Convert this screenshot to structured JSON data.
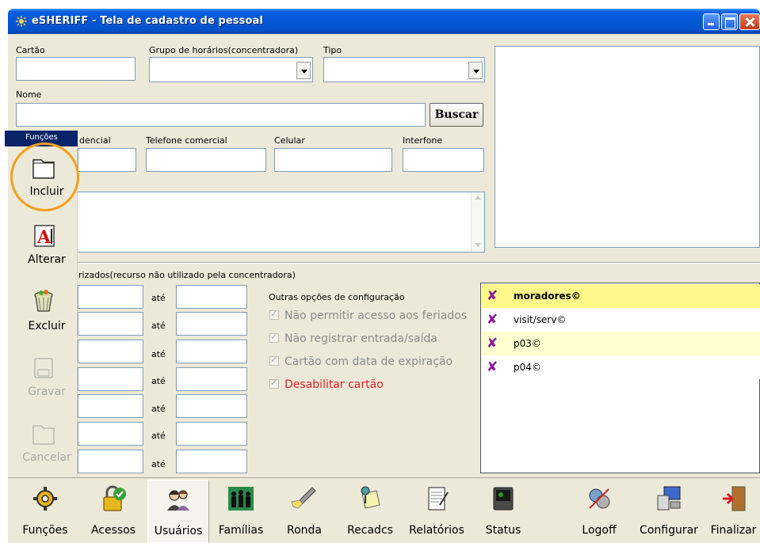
{
  "window": {
    "title": "eSHERIFF - Tela de cadastro de pessoal"
  },
  "form": {
    "cartao_label": "Cartão",
    "cartao_value": "",
    "grupo_label": "Grupo de horários(concentradora)",
    "grupo_value": "",
    "tipo_label": "Tipo",
    "tipo_value": "",
    "nome_label": "Nome",
    "nome_value": "",
    "buscar_label": "Buscar",
    "residencial_label": "dencial",
    "residencial_value": "",
    "tel_comercial_label": "Telefone comercial",
    "tel_comercial_value": "",
    "celular_label": "Celular",
    "celular_value": "",
    "interfone_label": "Interfone",
    "interfone_value": "",
    "notes_value": ""
  },
  "access": {
    "section_label": "rizados(recurso não utilizado pela concentradora)",
    "ate_label": "até",
    "ranges": [
      {
        "from": "",
        "to": ""
      },
      {
        "from": "",
        "to": ""
      },
      {
        "from": "",
        "to": ""
      },
      {
        "from": "",
        "to": ""
      },
      {
        "from": "",
        "to": ""
      },
      {
        "from": "",
        "to": ""
      },
      {
        "from": "",
        "to": ""
      }
    ]
  },
  "options": {
    "title": "Outras opções de configuração",
    "items": [
      {
        "label": "Não permitir acesso aos feriados",
        "checked": true,
        "color": "#8a8a8a"
      },
      {
        "label": "Não registrar entrada/saída",
        "checked": true,
        "color": "#8a8a8a"
      },
      {
        "label": "Cartão com data de expiração",
        "checked": true,
        "color": "#8a8a8a"
      },
      {
        "label": "Desabilitar cartão",
        "checked": true,
        "color": "#e02020"
      }
    ]
  },
  "groups": {
    "items": [
      {
        "mark": "✘",
        "label": "moradores©",
        "bg": "#fff88a",
        "bold": true
      },
      {
        "mark": "✘",
        "label": "visit/serv©",
        "bg": "#ffffff",
        "bold": false
      },
      {
        "mark": "✘",
        "label": "p03©",
        "bg": "#ffffd0",
        "bold": false
      },
      {
        "mark": "✘",
        "label": "p04©",
        "bg": "#ffffff",
        "bold": false
      }
    ]
  },
  "funcoes": {
    "header": "Funções",
    "buttons": [
      {
        "label": "Incluir",
        "icon": "folder-icon",
        "enabled": true
      },
      {
        "label": "Alterar",
        "icon": "edit-a-icon",
        "enabled": true
      },
      {
        "label": "Excluir",
        "icon": "trash-icon",
        "enabled": true
      },
      {
        "label": "Gravar",
        "icon": "save-icon",
        "enabled": false
      },
      {
        "label": "Cancelar",
        "icon": "folder-icon",
        "enabled": false
      }
    ]
  },
  "toolbar": {
    "buttons": [
      {
        "label": "Funções",
        "icon": "gear-icon"
      },
      {
        "label": "Acessos",
        "icon": "lock-check-icon"
      },
      {
        "label": "Usuários",
        "icon": "users-icon",
        "active": true
      },
      {
        "label": "Famílias",
        "icon": "family-icon"
      },
      {
        "label": "Ronda",
        "icon": "flashlight-icon"
      },
      {
        "label": "Recadcs",
        "icon": "messages-icon"
      },
      {
        "label": "Relatórios",
        "icon": "report-icon"
      },
      {
        "label": "Status",
        "icon": "status-monitor-icon"
      },
      {
        "label": "Logoff",
        "icon": "logoff-icon"
      },
      {
        "label": "Configurar",
        "icon": "computer-settings-icon"
      },
      {
        "label": "Finalizar",
        "icon": "exit-door-icon"
      }
    ]
  }
}
